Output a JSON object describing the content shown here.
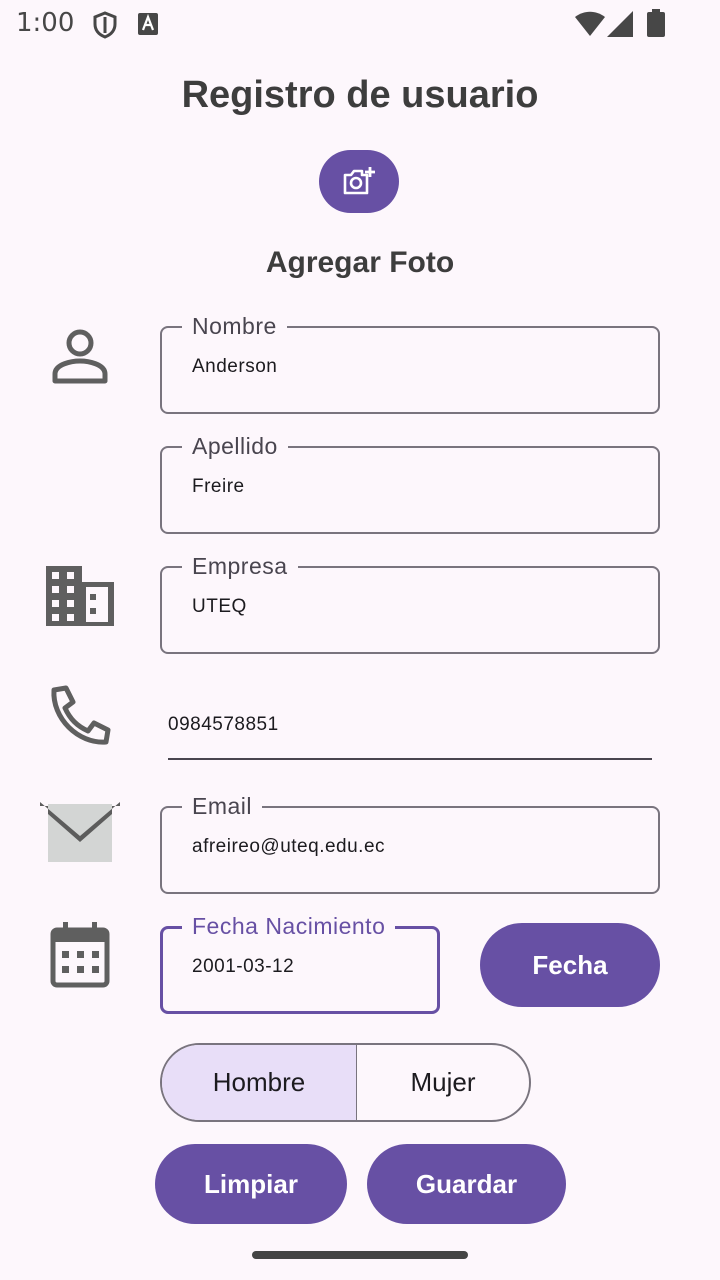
{
  "status_bar": {
    "time": "1:00"
  },
  "title": "Registro de usuario",
  "photo": {
    "label": "Agregar Foto",
    "icon": "add-a-photo-icon"
  },
  "fields": {
    "nombre": {
      "label": "Nombre",
      "value": "Anderson"
    },
    "apellido": {
      "label": "Apellido",
      "value": "Freire"
    },
    "empresa": {
      "label": "Empresa",
      "value": "UTEQ"
    },
    "telefono": {
      "value": "0984578851"
    },
    "email": {
      "label": "Email",
      "value": "afreireo@uteq.edu.ec"
    },
    "fecha": {
      "label": "Fecha Nacimiento",
      "value": "2001-03-12"
    }
  },
  "buttons": {
    "fecha": "Fecha",
    "limpiar": "Limpiar",
    "guardar": "Guardar"
  },
  "gender": {
    "options": [
      "Hombre",
      "Mujer"
    ],
    "selected": "Hombre"
  },
  "colors": {
    "primary": "#6750a4",
    "segment_selected": "#e8def8",
    "background": "#fdf7fc"
  }
}
